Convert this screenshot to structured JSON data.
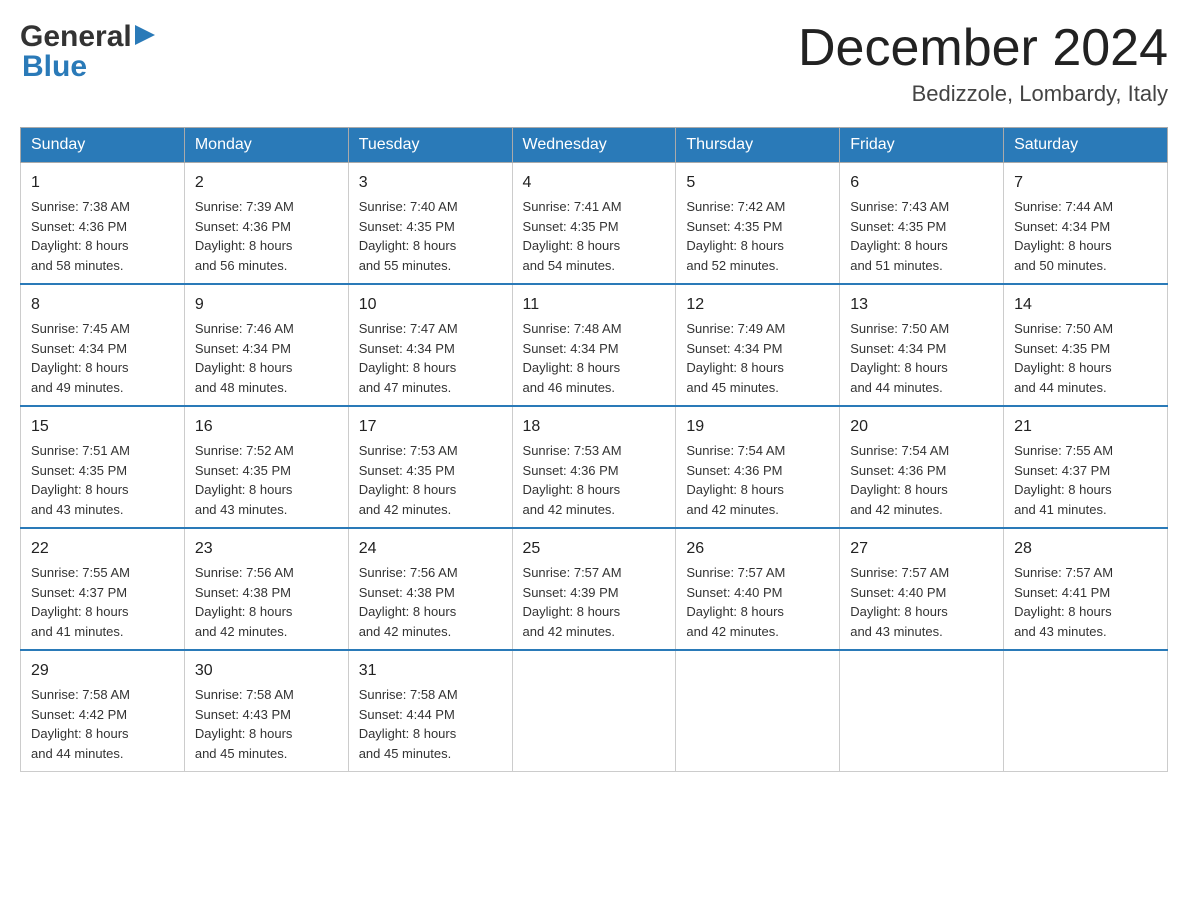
{
  "logo": {
    "general": "General",
    "blue": "Blue",
    "triangle": "▶"
  },
  "header": {
    "month_title": "December 2024",
    "location": "Bedizzole, Lombardy, Italy"
  },
  "weekdays": [
    "Sunday",
    "Monday",
    "Tuesday",
    "Wednesday",
    "Thursday",
    "Friday",
    "Saturday"
  ],
  "weeks": [
    [
      {
        "day": "1",
        "sunrise": "7:38 AM",
        "sunset": "4:36 PM",
        "daylight": "8 hours and 58 minutes."
      },
      {
        "day": "2",
        "sunrise": "7:39 AM",
        "sunset": "4:36 PM",
        "daylight": "8 hours and 56 minutes."
      },
      {
        "day": "3",
        "sunrise": "7:40 AM",
        "sunset": "4:35 PM",
        "daylight": "8 hours and 55 minutes."
      },
      {
        "day": "4",
        "sunrise": "7:41 AM",
        "sunset": "4:35 PM",
        "daylight": "8 hours and 54 minutes."
      },
      {
        "day": "5",
        "sunrise": "7:42 AM",
        "sunset": "4:35 PM",
        "daylight": "8 hours and 52 minutes."
      },
      {
        "day": "6",
        "sunrise": "7:43 AM",
        "sunset": "4:35 PM",
        "daylight": "8 hours and 51 minutes."
      },
      {
        "day": "7",
        "sunrise": "7:44 AM",
        "sunset": "4:34 PM",
        "daylight": "8 hours and 50 minutes."
      }
    ],
    [
      {
        "day": "8",
        "sunrise": "7:45 AM",
        "sunset": "4:34 PM",
        "daylight": "8 hours and 49 minutes."
      },
      {
        "day": "9",
        "sunrise": "7:46 AM",
        "sunset": "4:34 PM",
        "daylight": "8 hours and 48 minutes."
      },
      {
        "day": "10",
        "sunrise": "7:47 AM",
        "sunset": "4:34 PM",
        "daylight": "8 hours and 47 minutes."
      },
      {
        "day": "11",
        "sunrise": "7:48 AM",
        "sunset": "4:34 PM",
        "daylight": "8 hours and 46 minutes."
      },
      {
        "day": "12",
        "sunrise": "7:49 AM",
        "sunset": "4:34 PM",
        "daylight": "8 hours and 45 minutes."
      },
      {
        "day": "13",
        "sunrise": "7:50 AM",
        "sunset": "4:34 PM",
        "daylight": "8 hours and 44 minutes."
      },
      {
        "day": "14",
        "sunrise": "7:50 AM",
        "sunset": "4:35 PM",
        "daylight": "8 hours and 44 minutes."
      }
    ],
    [
      {
        "day": "15",
        "sunrise": "7:51 AM",
        "sunset": "4:35 PM",
        "daylight": "8 hours and 43 minutes."
      },
      {
        "day": "16",
        "sunrise": "7:52 AM",
        "sunset": "4:35 PM",
        "daylight": "8 hours and 43 minutes."
      },
      {
        "day": "17",
        "sunrise": "7:53 AM",
        "sunset": "4:35 PM",
        "daylight": "8 hours and 42 minutes."
      },
      {
        "day": "18",
        "sunrise": "7:53 AM",
        "sunset": "4:36 PM",
        "daylight": "8 hours and 42 minutes."
      },
      {
        "day": "19",
        "sunrise": "7:54 AM",
        "sunset": "4:36 PM",
        "daylight": "8 hours and 42 minutes."
      },
      {
        "day": "20",
        "sunrise": "7:54 AM",
        "sunset": "4:36 PM",
        "daylight": "8 hours and 42 minutes."
      },
      {
        "day": "21",
        "sunrise": "7:55 AM",
        "sunset": "4:37 PM",
        "daylight": "8 hours and 41 minutes."
      }
    ],
    [
      {
        "day": "22",
        "sunrise": "7:55 AM",
        "sunset": "4:37 PM",
        "daylight": "8 hours and 41 minutes."
      },
      {
        "day": "23",
        "sunrise": "7:56 AM",
        "sunset": "4:38 PM",
        "daylight": "8 hours and 42 minutes."
      },
      {
        "day": "24",
        "sunrise": "7:56 AM",
        "sunset": "4:38 PM",
        "daylight": "8 hours and 42 minutes."
      },
      {
        "day": "25",
        "sunrise": "7:57 AM",
        "sunset": "4:39 PM",
        "daylight": "8 hours and 42 minutes."
      },
      {
        "day": "26",
        "sunrise": "7:57 AM",
        "sunset": "4:40 PM",
        "daylight": "8 hours and 42 minutes."
      },
      {
        "day": "27",
        "sunrise": "7:57 AM",
        "sunset": "4:40 PM",
        "daylight": "8 hours and 43 minutes."
      },
      {
        "day": "28",
        "sunrise": "7:57 AM",
        "sunset": "4:41 PM",
        "daylight": "8 hours and 43 minutes."
      }
    ],
    [
      {
        "day": "29",
        "sunrise": "7:58 AM",
        "sunset": "4:42 PM",
        "daylight": "8 hours and 44 minutes."
      },
      {
        "day": "30",
        "sunrise": "7:58 AM",
        "sunset": "4:43 PM",
        "daylight": "8 hours and 45 minutes."
      },
      {
        "day": "31",
        "sunrise": "7:58 AM",
        "sunset": "4:44 PM",
        "daylight": "8 hours and 45 minutes."
      },
      null,
      null,
      null,
      null
    ]
  ],
  "labels": {
    "sunrise": "Sunrise:",
    "sunset": "Sunset:",
    "daylight": "Daylight:"
  }
}
